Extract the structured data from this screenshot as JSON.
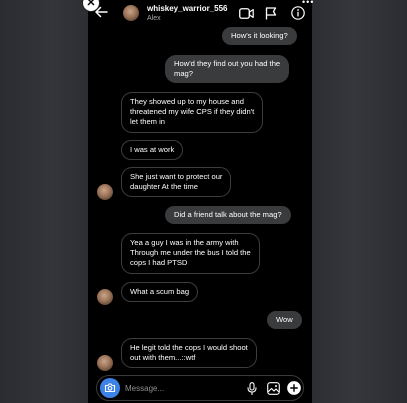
{
  "header": {
    "username": "whiskey_warrior_556",
    "name": "Alex",
    "close_glyph": "✕",
    "more_glyph": "•••",
    "icons": [
      "back-arrow-icon",
      "video-call-icon",
      "flag-icon",
      "info-icon"
    ]
  },
  "messages": [
    {
      "from": "me",
      "lines": [
        "How's it looking?"
      ]
    },
    {
      "from": "me",
      "lines": [
        "How'd they find out you had the",
        "mag?"
      ]
    },
    {
      "from": "them",
      "lines": [
        "They showed up to my house and",
        "threatened my wife CPS if they didn't",
        "let them in"
      ]
    },
    {
      "from": "them",
      "lines": [
        "I was at work"
      ]
    },
    {
      "from": "them",
      "lines": [
        "She just want to protect our",
        "daughter At the time"
      ]
    },
    {
      "from": "me",
      "lines": [
        "Did a friend talk about the mag?"
      ]
    },
    {
      "from": "them",
      "lines": [
        "Yea a guy I was in the army with",
        "Through me under the bus I told the",
        "cops I had PTSD"
      ]
    },
    {
      "from": "them",
      "lines": [
        "What a scum bag"
      ]
    },
    {
      "from": "me",
      "lines": [
        "Wow"
      ]
    },
    {
      "from": "them",
      "lines": [
        "He legit told the cops I would shoot",
        "out with them...::wtf"
      ]
    }
  ],
  "composer": {
    "placeholder": "Message...",
    "icons": [
      "camera-icon",
      "microphone-icon",
      "gallery-icon",
      "plus-icon"
    ]
  },
  "colors": {
    "outgoing_bubble": "#3a3b3d",
    "camera_button": "#3d82e6",
    "background": "#000000"
  }
}
